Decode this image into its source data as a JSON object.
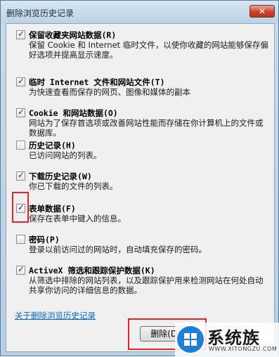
{
  "window": {
    "title": "删除浏览历史记录",
    "close_label": "✕"
  },
  "items": [
    {
      "checked": true,
      "title": "保留收藏夹网站数据(R)",
      "desc": "保留 Cookie 和 Internet 临时文件，以使你收藏的网站能够保存偏好选项并提高显示速度。"
    },
    {
      "checked": true,
      "title": "临时 Internet 文件和网站文件(T)",
      "desc": "为快速查看而保存的网页、图像和媒体的副本"
    },
    {
      "checked": true,
      "title": "Cookie 和网站数据(O)",
      "desc": "网站为了保存首选项或改善网站性能而存储在你计算机上的文件或数据库。"
    },
    {
      "checked": false,
      "title": "历史记录(H)",
      "desc": "已访问网站的列表。"
    },
    {
      "checked": true,
      "title": "下载历史记录(W)",
      "desc": "你已下载的文件的列表。"
    },
    {
      "checked": true,
      "title": "表单数据(F)",
      "desc": "保存在表单中键入的信息。"
    },
    {
      "checked": false,
      "title": "密码(P)",
      "desc": "登录以前访问过的网站时，自动填充保存的密码。"
    },
    {
      "checked": true,
      "title": "ActiveX 筛选和跟踪保护数据(K)",
      "desc": "从筛选中排除的网站列表，以及跟踪保护用来检测网站在何处自动共享你访问的详细信息的数据。"
    }
  ],
  "footer": {
    "link": "关于删除浏览历史记录",
    "delete_button": "删除(D)"
  },
  "watermark": {
    "text": "系统族",
    "url": "WWW.XITONGZU.COM"
  }
}
